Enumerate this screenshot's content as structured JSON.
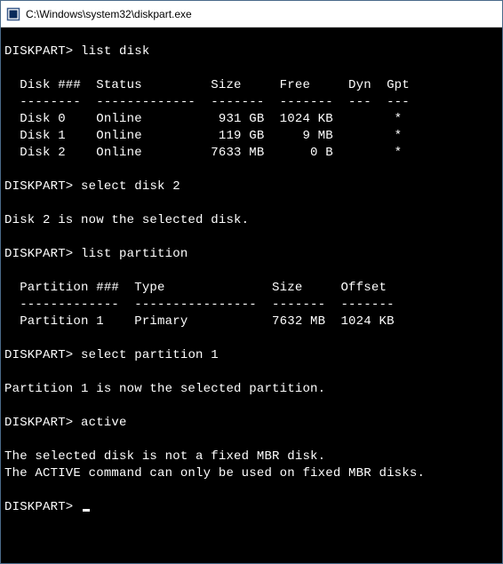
{
  "window": {
    "title": "C:\\Windows\\system32\\diskpart.exe"
  },
  "prompt": "DISKPART>",
  "commands": {
    "list_disk": "list disk",
    "select_disk_2": "select disk 2",
    "list_partition": "list partition",
    "select_partition_1": "select partition 1",
    "active": "active"
  },
  "disk_table": {
    "header": "  Disk ###  Status         Size     Free     Dyn  Gpt",
    "divider": "  --------  -------------  -------  -------  ---  ---",
    "rows": [
      "  Disk 0    Online          931 GB  1024 KB        *",
      "  Disk 1    Online          119 GB     9 MB        *",
      "  Disk 2    Online         7633 MB      0 B        *"
    ]
  },
  "messages": {
    "disk_selected": "Disk 2 is now the selected disk."
  },
  "partition_table": {
    "header": "  Partition ###  Type              Size     Offset",
    "divider": "  -------------  ----------------  -------  -------",
    "rows": [
      "  Partition 1    Primary           7632 MB  1024 KB"
    ]
  },
  "messages2": {
    "partition_selected": "Partition 1 is now the selected partition.",
    "active_error_1": "The selected disk is not a fixed MBR disk.",
    "active_error_2": "The ACTIVE command can only be used on fixed MBR disks."
  }
}
